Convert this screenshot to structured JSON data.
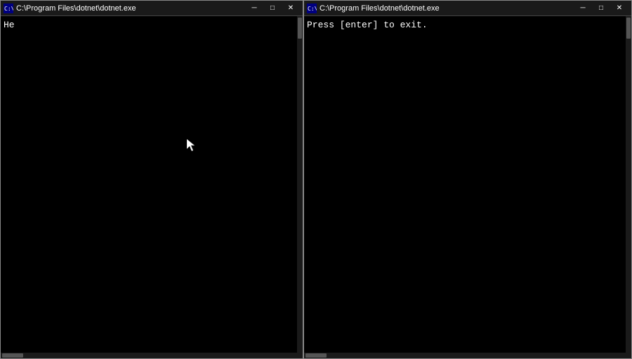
{
  "window_left": {
    "title": "C:\\Program Files\\dotnet\\dotnet.exe",
    "icon": "console-icon",
    "content_text": "He",
    "controls": {
      "minimize": "─",
      "maximize": "□",
      "close": "✕"
    }
  },
  "window_right": {
    "title": "C:\\Program Files\\dotnet\\dotnet.exe",
    "icon": "console-icon",
    "content_text": "Press [enter] to exit.",
    "controls": {
      "minimize": "─",
      "maximize": "□",
      "close": "✕"
    }
  }
}
